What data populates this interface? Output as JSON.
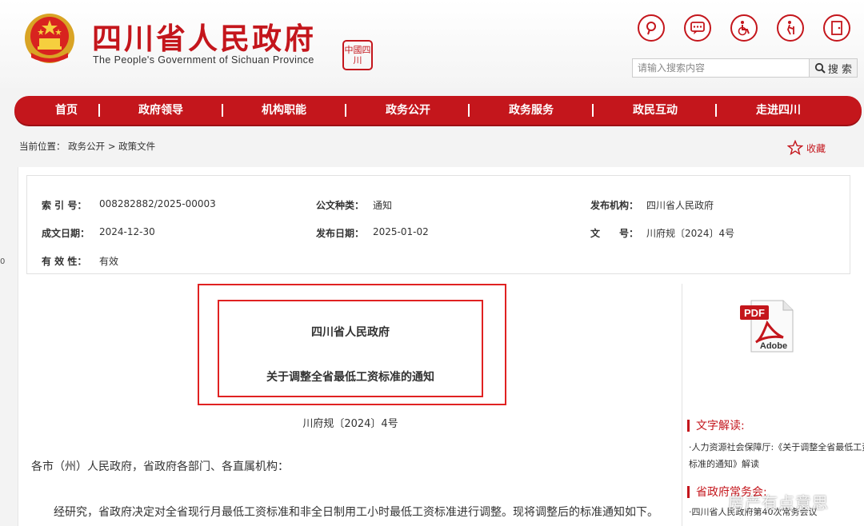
{
  "header": {
    "title": "四川省人民政府",
    "subtitle": "The People's Government of Sichuan Province",
    "seal_text": "中國四川",
    "search_placeholder": "请输入搜索内容",
    "search_button": "搜 索",
    "icons": [
      "pin-icon",
      "chat-icon",
      "wheelchair-icon",
      "elderly-icon",
      "exit-icon"
    ]
  },
  "nav": {
    "items": [
      "首页",
      "政府领导",
      "机构职能",
      "政务公开",
      "政务服务",
      "政民互动",
      "走进四川"
    ]
  },
  "breadcrumb": {
    "prefix": "当前位置：",
    "items": [
      "政务公开",
      "政策文件"
    ],
    "separator": ">"
  },
  "favorite_label": "收藏",
  "meta": {
    "index_label": "索 引 号：",
    "index_value": "008282882/2025-00003",
    "type_label": "公文种类：",
    "type_value": "通知",
    "org_label": "发布机构：",
    "org_value": "四川省人民政府",
    "created_label": "成文日期：",
    "created_value": "2024-12-30",
    "published_label": "发布日期：",
    "published_value": "2025-01-02",
    "docno_label": "文　　号：",
    "docno_value": "川府规〔2024〕4号",
    "valid_label": "有 效 性：",
    "valid_value": "有效"
  },
  "document": {
    "issuer": "四川省人民政府",
    "title": "关于调整全省最低工资标准的通知",
    "doc_number": "川府规〔2024〕4号",
    "salutation": "各市（州）人民政府，省政府各部门、各直属机构：",
    "body_first": "经研究，省政府决定对全省现行月最低工资标准和非全日制用工小时最低工资标准进行调整。现将调整后的标准通知如下。"
  },
  "sidebar": {
    "pdf_label": "PDF",
    "adobe_label": "Adobe",
    "interpretation_heading": "文字解读:",
    "interpretation_link": "·人力资源社会保障厅:《关于调整全省最低工资标准的通知》解读",
    "meeting_heading": "省政府常务会:",
    "meeting_link": "·四川省人民政府第40次常务会议"
  },
  "watermark": "房产有点意思",
  "edge_mark": "0",
  "colors": {
    "brand_red": "#c4161c",
    "highlight_red": "#e02222"
  }
}
